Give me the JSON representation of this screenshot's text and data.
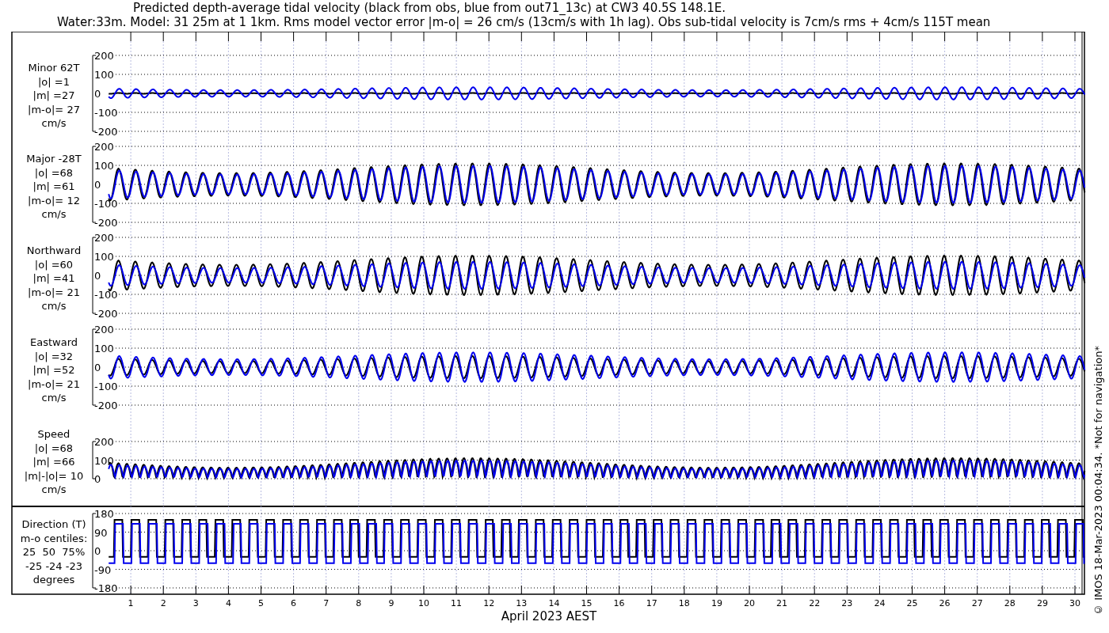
{
  "title": [
    "Predicted depth-average tidal velocity (black from obs, blue from out71_13c) at CW3 40.5S 148.1E.",
    "Water:33m. Model: 31 25m at 1 1km. Rms model vector error |m-o| = 26 cm/s (13cm/s with 1h lag). Obs sub-tidal velocity is 7cm/s rms + 4cm/s 115T mean"
  ],
  "panels": [
    {
      "kind": "velocity",
      "label": [
        "Minor 62T",
        "|o| =1",
        "|m| =27",
        "|m-o|= 27",
        "cm/s"
      ],
      "yticks": [
        "200",
        "100",
        "0",
        "-100",
        "-200"
      ]
    },
    {
      "kind": "velocity",
      "label": [
        "Major -28T",
        "|o| =68",
        "|m| =61",
        "|m-o|= 12",
        "cm/s"
      ],
      "yticks": [
        "200",
        "100",
        "0",
        "-100",
        "-200"
      ]
    },
    {
      "kind": "velocity",
      "label": [
        "Northward",
        "|o| =60",
        "|m| =41",
        "|m-o|= 21",
        "cm/s"
      ],
      "yticks": [
        "200",
        "100",
        "0",
        "-100",
        "-200"
      ]
    },
    {
      "kind": "velocity",
      "label": [
        "Eastward",
        "|o| =32",
        "|m| =52",
        "|m-o|= 21",
        "cm/s"
      ],
      "yticks": [
        "200",
        "100",
        "0",
        "-100",
        "-200"
      ]
    },
    {
      "kind": "speed",
      "label": [
        "Speed",
        "|o| =68",
        "|m| =66",
        "|m|-|o|= 10",
        "cm/s"
      ],
      "yticks": [
        "200",
        "100",
        "0"
      ]
    },
    {
      "kind": "direction",
      "label": [
        "Direction (T)",
        "m-o centiles:",
        "25  50  75%",
        "-25 -24 -23",
        "degrees"
      ],
      "yticks": [
        "180",
        "90",
        "0",
        "-90",
        "-180"
      ]
    }
  ],
  "xaxis": {
    "ticks": [
      "1",
      "2",
      "3",
      "4",
      "5",
      "6",
      "7",
      "8",
      "9",
      "10",
      "11",
      "12",
      "13",
      "14",
      "15",
      "16",
      "17",
      "18",
      "19",
      "20",
      "21",
      "22",
      "23",
      "24",
      "25",
      "26",
      "27",
      "28",
      "29",
      "30"
    ],
    "label": "April 2023 AEST"
  },
  "credit": "© IMOS 18-Mar-2023 00:04:34. *Not for navigation*"
}
